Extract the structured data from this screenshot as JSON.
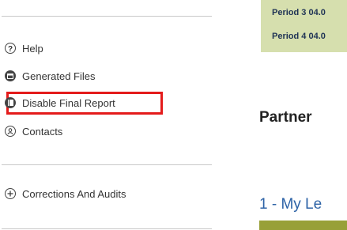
{
  "sidebar": {
    "items": [
      {
        "label": "Help",
        "icon": "help-icon"
      },
      {
        "label": "Generated Files",
        "icon": "generated-files-icon"
      },
      {
        "label": "Disable Final Report",
        "icon": "report-icon",
        "highlighted": true
      },
      {
        "label": "Contacts",
        "icon": "contact-icon"
      },
      {
        "label": "Corrections And Audits",
        "icon": "plus-icon"
      }
    ]
  },
  "main": {
    "periods": [
      "Period 3 04.0",
      "Period 4 04.0"
    ],
    "section_heading": "Partner",
    "sub_heading": "1 - My Le"
  },
  "colors": {
    "highlight": "#e41b1b",
    "period_box": "#d6dfae",
    "period_text": "#1f3355",
    "link_blue": "#2c62a6",
    "olive_bar": "#98a038"
  }
}
